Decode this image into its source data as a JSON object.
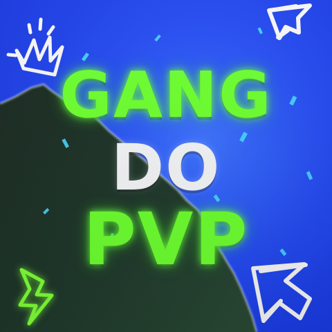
{
  "artwork": {
    "title_lines": [
      "GANG",
      "DO",
      "PVP"
    ],
    "palette": {
      "background_blue": "#2147f2",
      "foreground_dark": "#20392d",
      "text_white": "#f3f4f6",
      "text_green": "#6cff2e",
      "accent_white": "#ffffff"
    },
    "decorations": [
      "crown-doodle",
      "cursor-doodle-top",
      "cursor-doodle-bottom",
      "lightning-doodle"
    ]
  }
}
